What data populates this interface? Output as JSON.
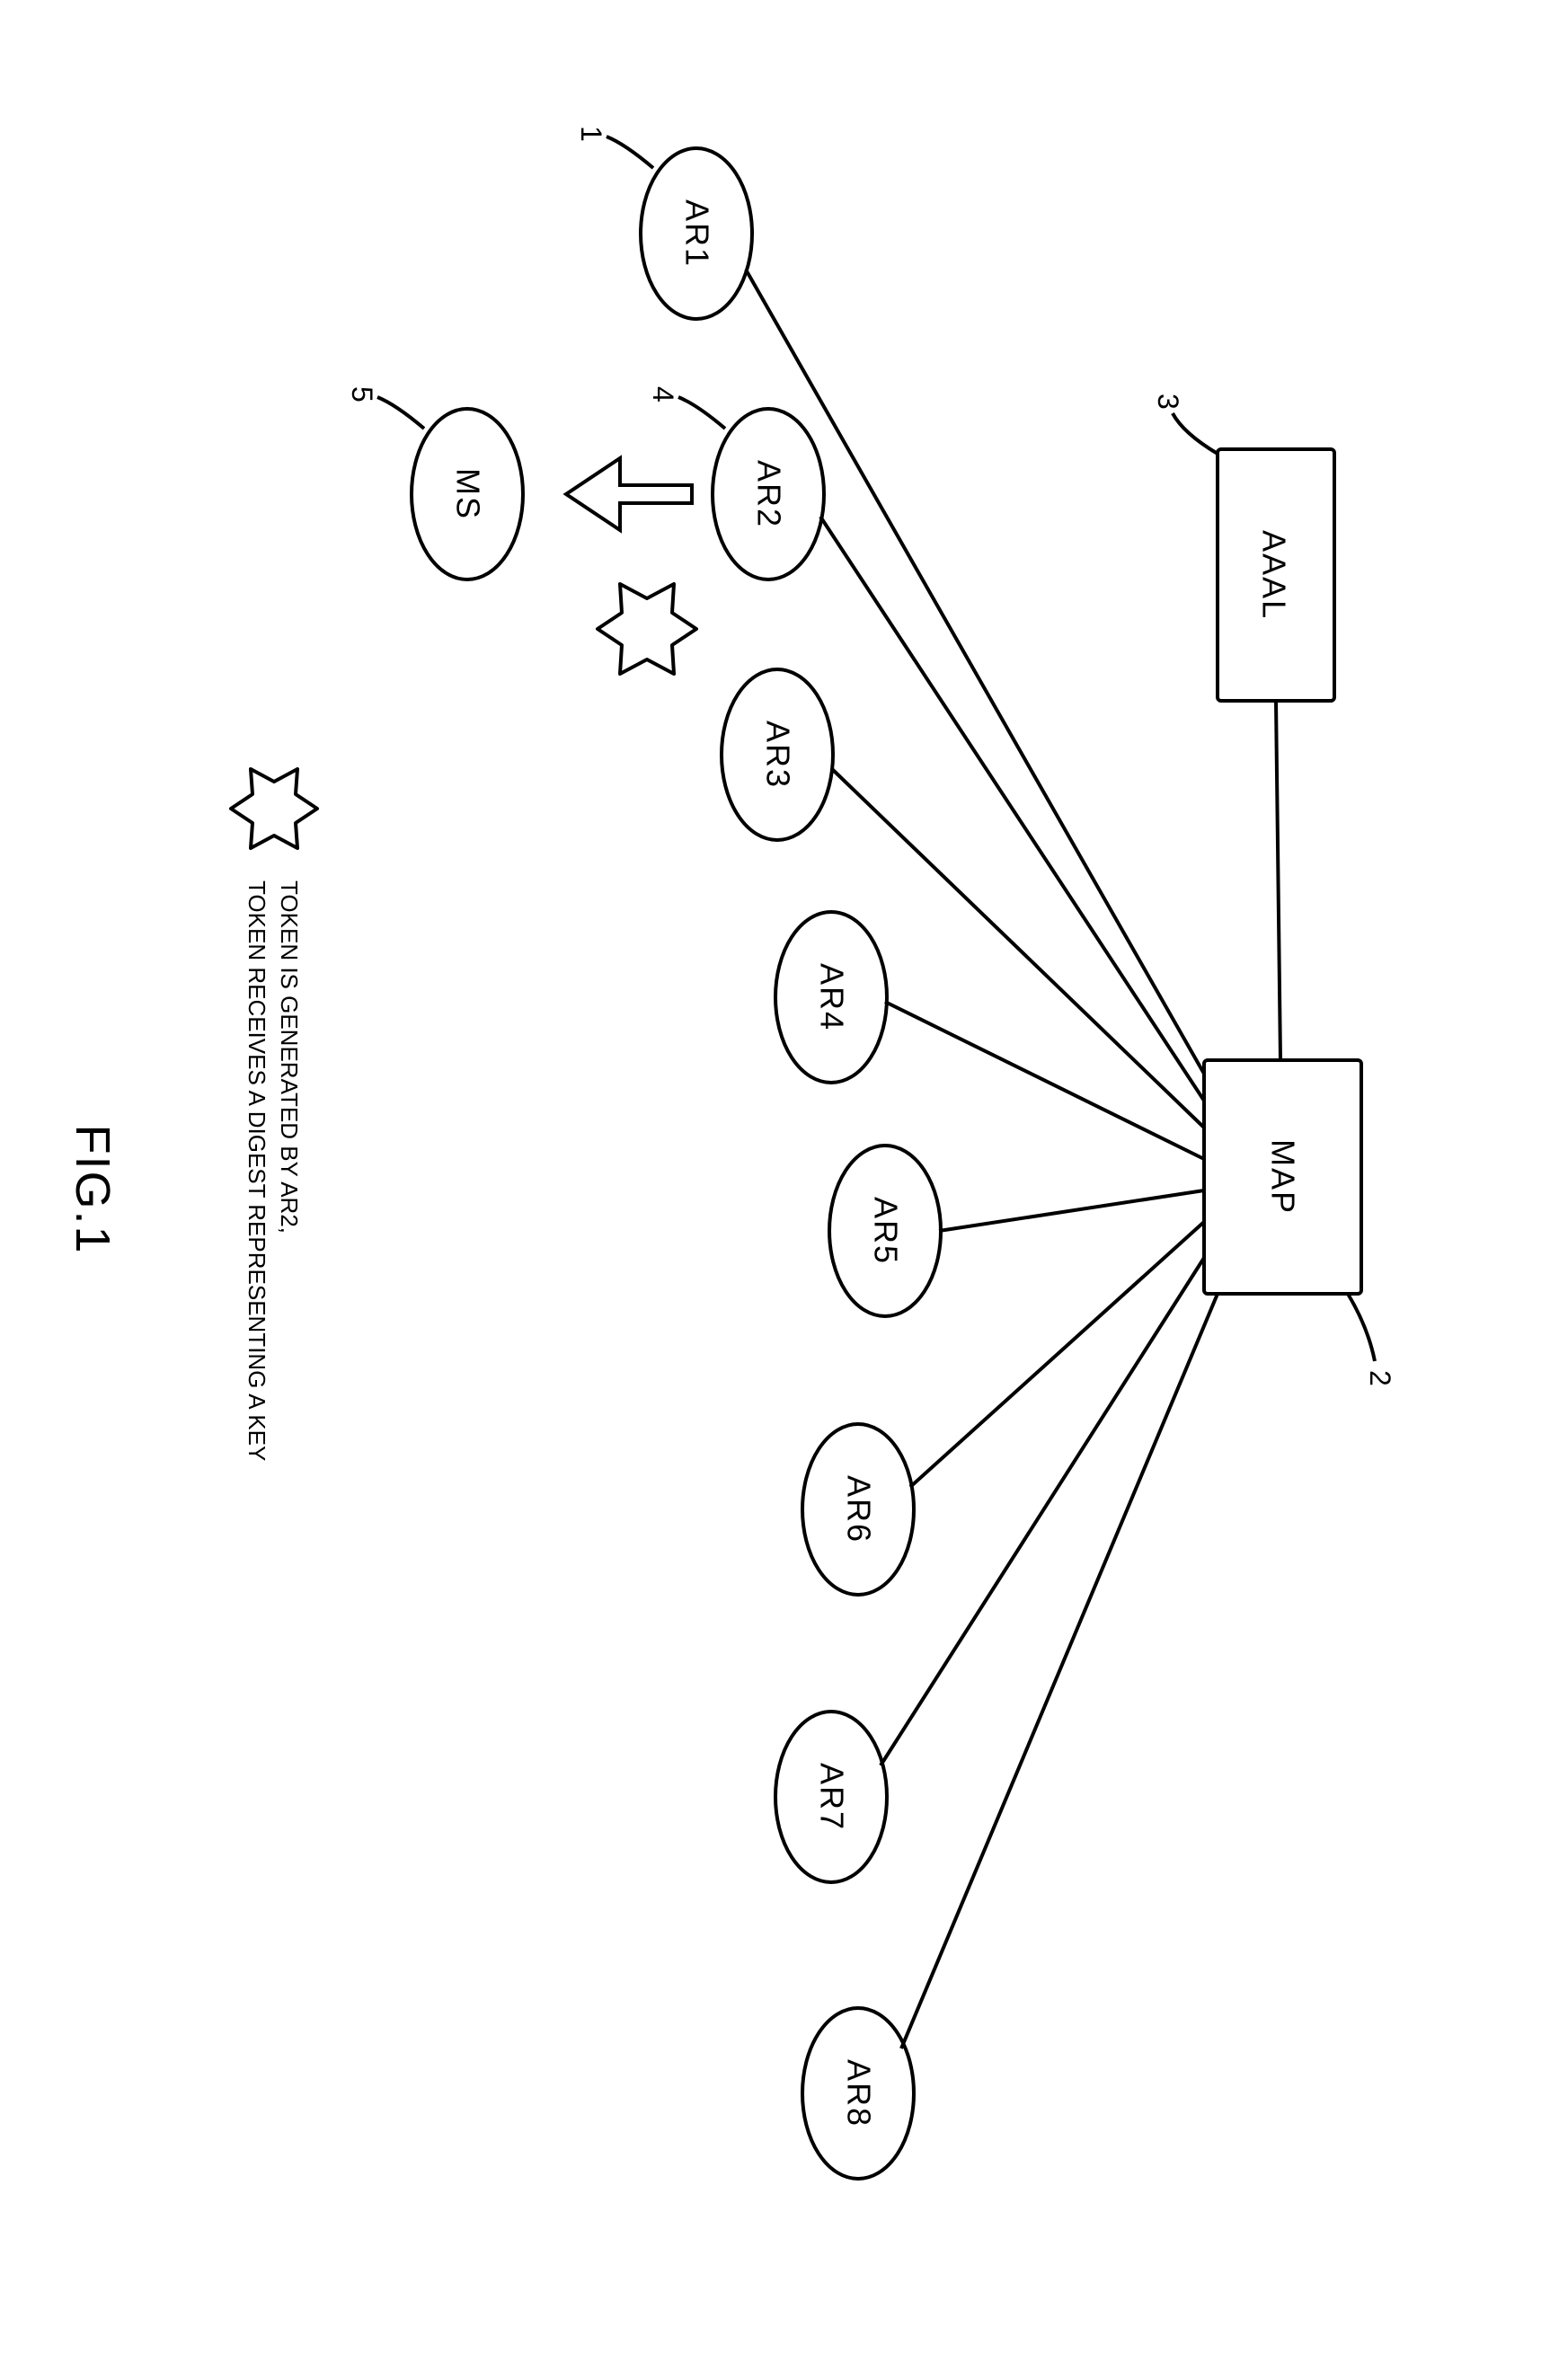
{
  "nodes": {
    "aaal": {
      "label": "AAAL",
      "leader": "3"
    },
    "map": {
      "label": "MAP",
      "leader": "2"
    },
    "ar1": {
      "label": "AR1",
      "leader": "1"
    },
    "ar2": {
      "label": "AR2",
      "leader": "4"
    },
    "ar3": {
      "label": "AR3"
    },
    "ar4": {
      "label": "AR4"
    },
    "ar5": {
      "label": "AR5"
    },
    "ar6": {
      "label": "AR6"
    },
    "ar7": {
      "label": "AR7"
    },
    "ar8": {
      "label": "AR8"
    },
    "ms": {
      "label": "MS",
      "leader": "5"
    }
  },
  "legend": {
    "line1": "TOKEN IS GENERATED BY AR2,",
    "line2": "TOKEN RECEIVES A DIGEST REPRESENTING A KEY"
  },
  "figure_label": "FIG.1"
}
